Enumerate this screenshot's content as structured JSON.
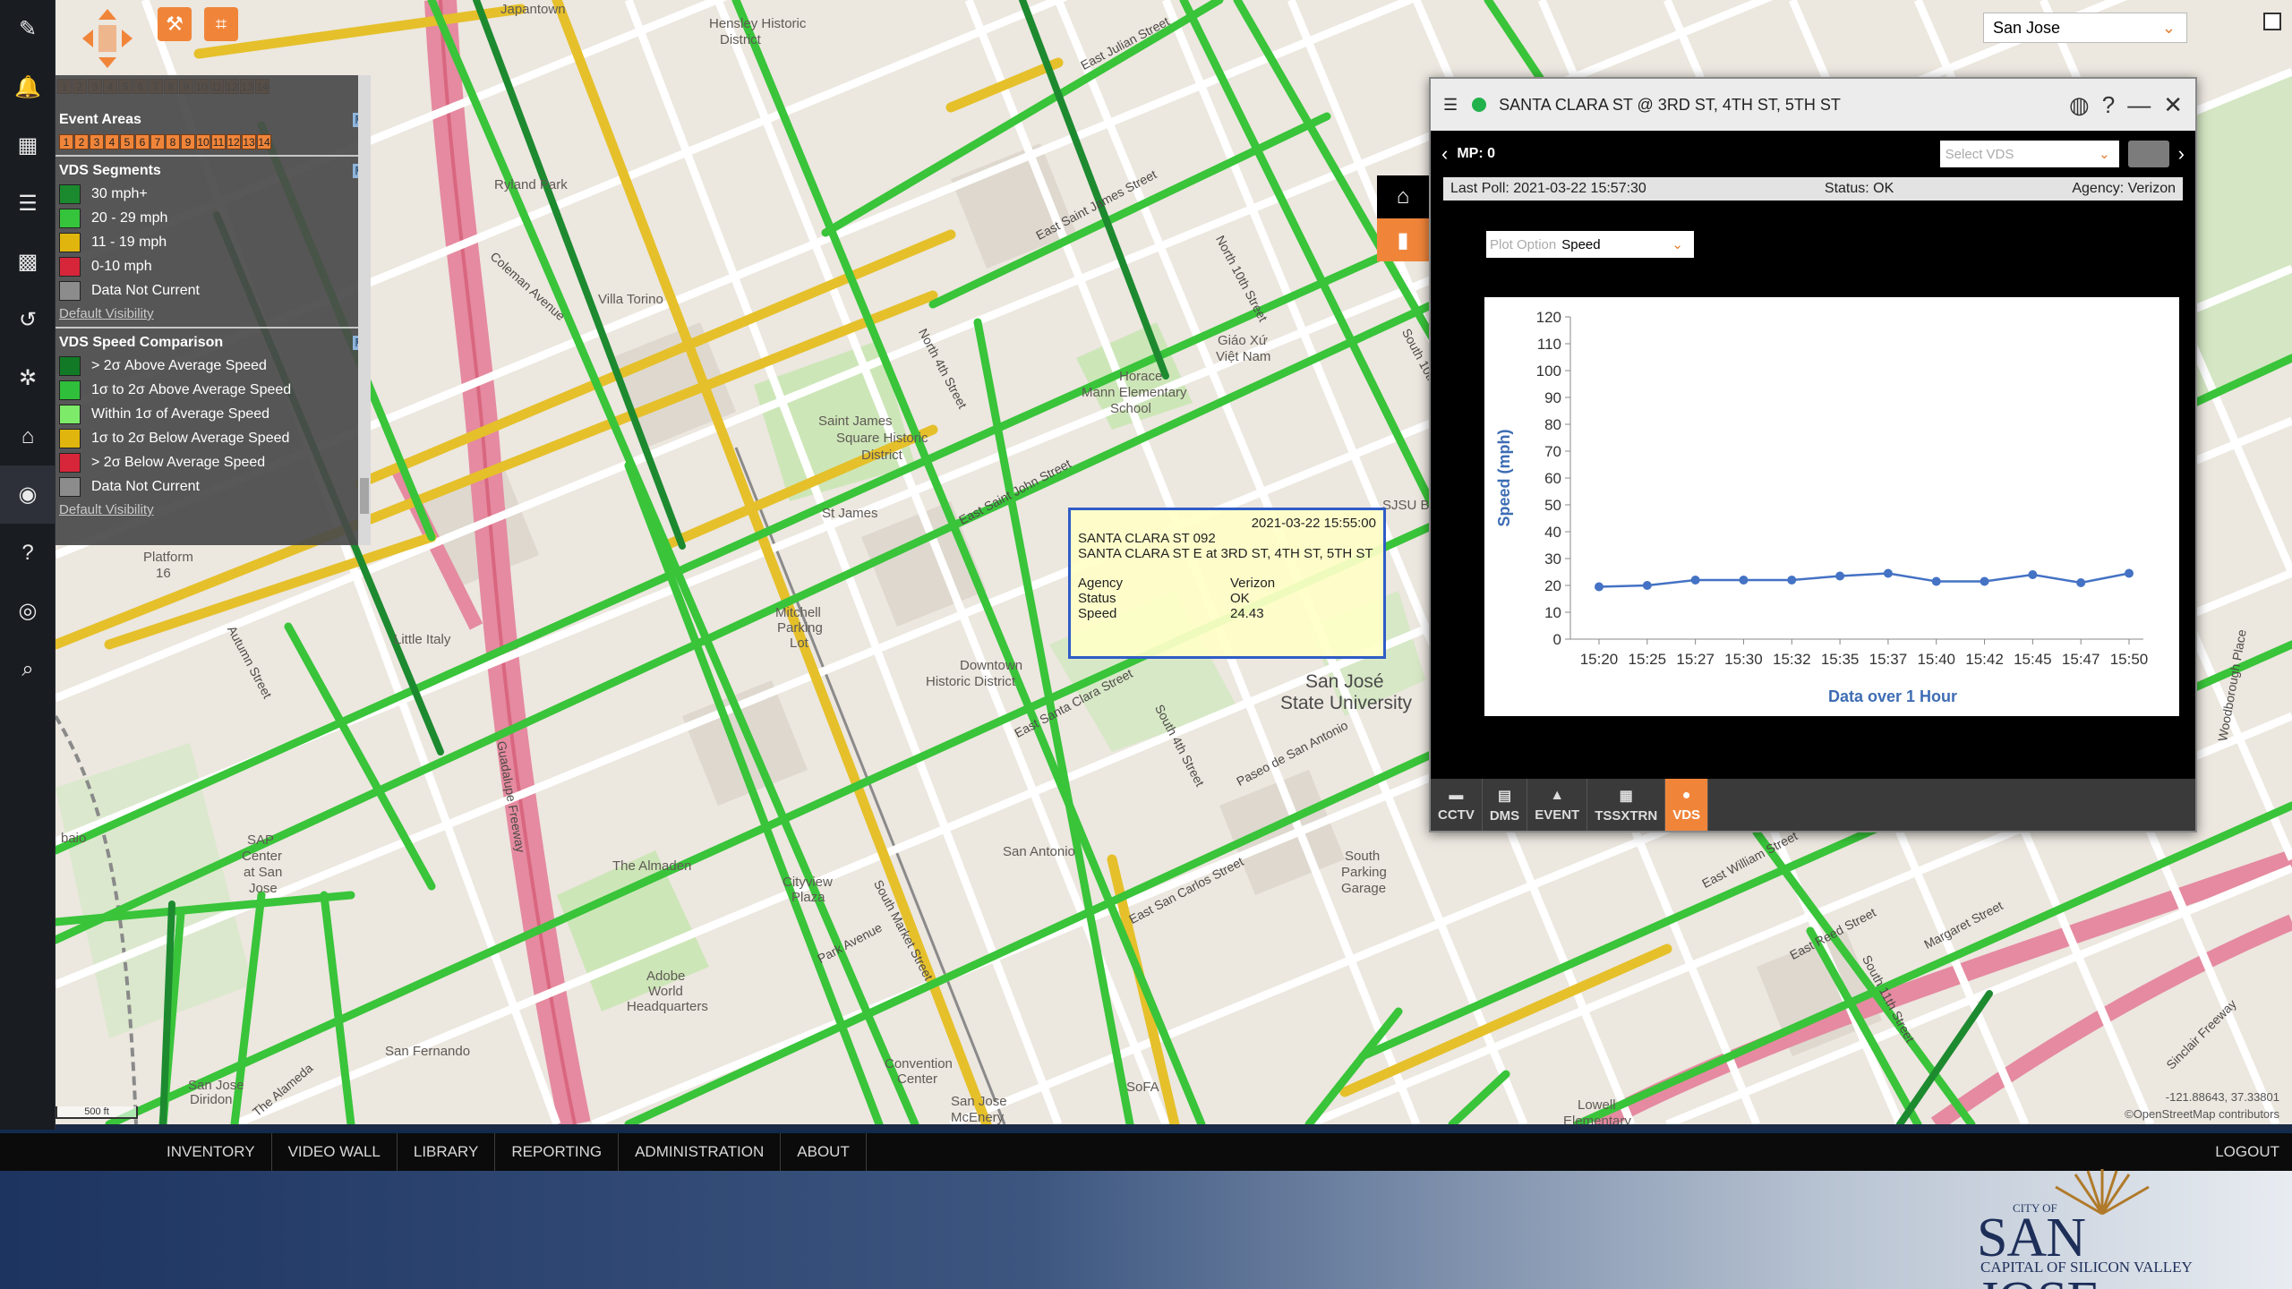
{
  "map": {
    "labels": [
      {
        "text": "Japantown",
        "x": 497,
        "y": 2
      },
      {
        "text": "Hensley Historic",
        "x": 730,
        "y": 18
      },
      {
        "text": "District",
        "x": 742,
        "y": 36
      },
      {
        "text": "Ryland Park",
        "x": 490,
        "y": 198
      },
      {
        "text": "Villa Torino",
        "x": 606,
        "y": 326
      },
      {
        "text": "Saint James",
        "x": 852,
        "y": 462
      },
      {
        "text": "Square Historic",
        "x": 872,
        "y": 481
      },
      {
        "text": "District",
        "x": 900,
        "y": 500
      },
      {
        "text": "St James",
        "x": 856,
        "y": 565
      },
      {
        "text": "Mitchell",
        "x": 804,
        "y": 676
      },
      {
        "text": "Parking",
        "x": 806,
        "y": 693
      },
      {
        "text": "Lot",
        "x": 820,
        "y": 710
      },
      {
        "text": "Downtown",
        "x": 1010,
        "y": 735
      },
      {
        "text": "Historic District",
        "x": 972,
        "y": 753
      },
      {
        "text": "San Antonio",
        "x": 1058,
        "y": 943
      },
      {
        "text": "Cityview",
        "x": 812,
        "y": 977
      },
      {
        "text": "Plaza",
        "x": 822,
        "y": 994
      },
      {
        "text": "The Almaden",
        "x": 622,
        "y": 959
      },
      {
        "text": "Adobe",
        "x": 660,
        "y": 1082
      },
      {
        "text": "World",
        "x": 662,
        "y": 1099
      },
      {
        "text": "Headquarters",
        "x": 638,
        "y": 1116
      },
      {
        "text": "Convention",
        "x": 926,
        "y": 1180
      },
      {
        "text": "Center",
        "x": 940,
        "y": 1197
      },
      {
        "text": "San Jose",
        "x": 1000,
        "y": 1222
      },
      {
        "text": "McEnery",
        "x": 1000,
        "y": 1240
      },
      {
        "text": "SoFA",
        "x": 1196,
        "y": 1206
      },
      {
        "text": "San Fernando",
        "x": 368,
        "y": 1166
      },
      {
        "text": "San Jose",
        "x": 148,
        "y": 1204
      },
      {
        "text": "Diridon",
        "x": 150,
        "y": 1220
      },
      {
        "text": "SAP",
        "x": 214,
        "y": 930
      },
      {
        "text": "Center",
        "x": 208,
        "y": 948
      },
      {
        "text": "at San",
        "x": 210,
        "y": 966
      },
      {
        "text": "Jose",
        "x": 216,
        "y": 984
      },
      {
        "text": "Little Italy",
        "x": 378,
        "y": 706
      },
      {
        "text": "Platform",
        "x": 98,
        "y": 614
      },
      {
        "text": "16",
        "x": 112,
        "y": 632
      },
      {
        "text": "Horace",
        "x": 1188,
        "y": 412
      },
      {
        "text": "Mann Elementary",
        "x": 1146,
        "y": 430
      },
      {
        "text": "School",
        "x": 1178,
        "y": 448
      },
      {
        "text": "Giáo Xứ",
        "x": 1298,
        "y": 372
      },
      {
        "text": "Việt Nam",
        "x": 1296,
        "y": 390
      },
      {
        "text": "SJSU Boyce",
        "x": 1482,
        "y": 556
      },
      {
        "text": "South",
        "x": 1440,
        "y": 948
      },
      {
        "text": "Parking",
        "x": 1436,
        "y": 966
      },
      {
        "text": "Garage",
        "x": 1436,
        "y": 984
      },
      {
        "text": "Lowell",
        "x": 1700,
        "y": 1226
      },
      {
        "text": "Elementary",
        "x": 1684,
        "y": 1244
      },
      {
        "text": "baio",
        "x": 6,
        "y": 928
      }
    ],
    "big_labels": [
      {
        "text": "San José",
        "x": 1396,
        "y": 750
      },
      {
        "text": "State University",
        "x": 1368,
        "y": 774
      }
    ],
    "street_labels": [
      {
        "text": "North 4th Street",
        "x": 968,
        "y": 360,
        "r": 62
      },
      {
        "text": "North 10th Street",
        "x": 1300,
        "y": 256,
        "r": 62
      },
      {
        "text": "East Santa Clara Street",
        "x": 1072,
        "y": 812,
        "r": -28
      },
      {
        "text": "East San Carlos Street",
        "x": 1200,
        "y": 1020,
        "r": -28
      },
      {
        "text": "East Saint John Street",
        "x": 1010,
        "y": 574,
        "r": -28
      },
      {
        "text": "South 10th Street",
        "x": 1508,
        "y": 360,
        "r": 62
      },
      {
        "text": "South 4th Street",
        "x": 1232,
        "y": 780,
        "r": 62
      },
      {
        "text": "South Market Street",
        "x": 918,
        "y": 976,
        "r": 62
      },
      {
        "text": "Park Avenue",
        "x": 852,
        "y": 1064,
        "r": -28
      },
      {
        "text": "Guadalupe Freeway",
        "x": 498,
        "y": 820,
        "r": 80
      },
      {
        "text": "Coleman Avenue",
        "x": 488,
        "y": 276,
        "r": 42
      },
      {
        "text": "East Julian Street",
        "x": 1146,
        "y": 66,
        "r": -28
      },
      {
        "text": "East Saint James Street",
        "x": 1096,
        "y": 256,
        "r": -28
      },
      {
        "text": "Paseo de San Antonio",
        "x": 1320,
        "y": 866,
        "r": -28
      },
      {
        "text": "East Reed Street",
        "x": 1938,
        "y": 1060,
        "r": -28
      },
      {
        "text": "Margaret Street",
        "x": 2088,
        "y": 1048,
        "r": -28
      },
      {
        "text": "East William Street",
        "x": 1840,
        "y": 980,
        "r": -28
      },
      {
        "text": "Woodborough Place",
        "x": 2420,
        "y": 820,
        "r": -80
      },
      {
        "text": "Sinclair Freeway",
        "x": 2360,
        "y": 1184,
        "r": -45
      },
      {
        "text": "South 11th Street",
        "x": 2022,
        "y": 1060,
        "r": 62
      },
      {
        "text": "Autumn Street",
        "x": 196,
        "y": 692,
        "r": 62
      },
      {
        "text": "The Alameda",
        "x": 222,
        "y": 1236,
        "r": -40
      }
    ]
  },
  "legend": {
    "top_strip": [
      "1",
      "2",
      "3",
      "4",
      "5",
      "6",
      "7",
      "8",
      "9",
      "10",
      "11",
      "12",
      "13",
      "14"
    ],
    "event_areas": {
      "title": "Event Areas",
      "strip": [
        "1",
        "2",
        "3",
        "4",
        "5",
        "6",
        "7",
        "8",
        "9",
        "10",
        "11",
        "12",
        "13",
        "14"
      ]
    },
    "vds_segments": {
      "title": "VDS Segments",
      "items": [
        {
          "label": "30 mph+",
          "color": "#1b8a2e"
        },
        {
          "label": "20 - 29 mph",
          "color": "#35c43c"
        },
        {
          "label": "11 - 19 mph",
          "color": "#e0b60e"
        },
        {
          "label": "0-10 mph",
          "color": "#d7263a"
        },
        {
          "label": "Data Not Current",
          "color": "#8c8c8c"
        }
      ],
      "link": "Default Visibility"
    },
    "vds_speed": {
      "title": "VDS Speed Comparison",
      "items": [
        {
          "label": "> 2σ Above Average Speed",
          "color": "#127a26"
        },
        {
          "label": "1σ to 2σ Above Average Speed",
          "color": "#2fbf3a"
        },
        {
          "label": "Within 1σ of Average Speed",
          "color": "#7dea6a"
        },
        {
          "label": "1σ to 2σ Below Average Speed",
          "color": "#e0b60e"
        },
        {
          "label": "> 2σ Below Average Speed",
          "color": "#d7263a"
        },
        {
          "label": "Data Not Current",
          "color": "#8c8c8c"
        }
      ],
      "link": "Default Visibility"
    }
  },
  "city_select": {
    "value": "San Jose"
  },
  "vds": {
    "title": "SANTA CLARA ST @ 3RD ST, 4TH ST, 5TH ST",
    "mp": "MP: 0",
    "select_placeholder": "Select VDS",
    "last_poll": "Last Poll: 2021-03-22 15:57:30",
    "status": "Status: OK",
    "agency": "Agency: Verizon",
    "plot_option_placeholder": "Plot Option",
    "plot_option_value": "Speed",
    "tabs": [
      {
        "label": "CCTV",
        "icon": "camera-icon"
      },
      {
        "label": "DMS",
        "icon": "sign-icon"
      },
      {
        "label": "EVENT",
        "icon": "warning-icon"
      },
      {
        "label": "TSSXTRN",
        "icon": "signal-icon"
      },
      {
        "label": "VDS",
        "icon": "sensor-icon"
      }
    ]
  },
  "chart_data": {
    "type": "line",
    "x": [
      "15:20",
      "15:25",
      "15:27",
      "15:30",
      "15:32",
      "15:35",
      "15:37",
      "15:40",
      "15:42",
      "15:45",
      "15:47",
      "15:50"
    ],
    "series": [
      {
        "values": [
          19.5,
          20,
          22,
          22,
          22,
          23.5,
          24.5,
          21.5,
          21.5,
          24,
          21,
          24.5
        ]
      }
    ],
    "xlabel": "Data over 1 Hour",
    "ylabel": "Speed (mph)",
    "ylim": [
      0,
      120
    ],
    "yticks": [
      0,
      10,
      20,
      30,
      40,
      50,
      60,
      70,
      80,
      90,
      100,
      110,
      120
    ],
    "color": "#4472c4"
  },
  "tooltip": {
    "timestamp": "2021-03-22 15:55:00",
    "line1": "SANTA CLARA ST 092",
    "line2": "SANTA CLARA ST E at 3RD ST, 4TH ST, 5TH ST",
    "rows": [
      {
        "k": "Agency",
        "v": "Verizon"
      },
      {
        "k": "Status",
        "v": "OK"
      },
      {
        "k": "Speed",
        "v": "24.43"
      }
    ]
  },
  "scale": "500 ft",
  "coords": "-121.88643, 37.33801",
  "attribution": "©OpenStreetMap contributors",
  "nav": [
    "INVENTORY",
    "VIDEO WALL",
    "LIBRARY",
    "REPORTING",
    "ADMINISTRATION",
    "ABOUT"
  ],
  "logout": "LOGOUT",
  "logo": {
    "small": "CITY OF",
    "big": "SAN JOSE",
    "tag": "CAPITAL OF SILICON VALLEY"
  }
}
